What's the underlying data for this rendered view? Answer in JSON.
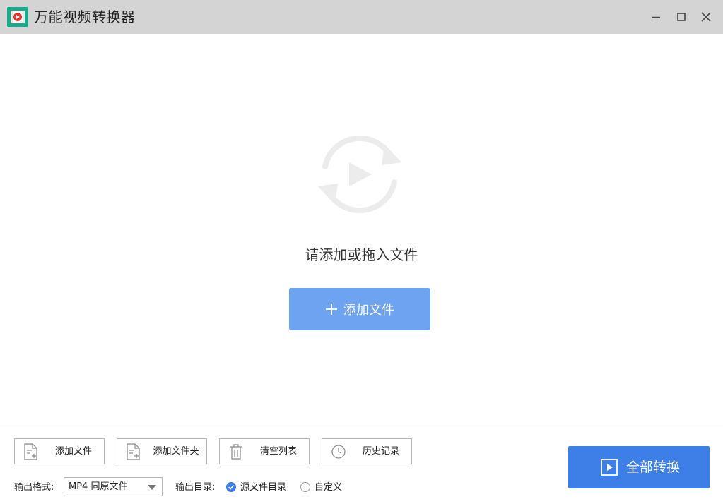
{
  "window": {
    "title": "万能视频转换器",
    "controls": [
      "minimize-icon",
      "maximize-icon",
      "close-icon"
    ]
  },
  "empty_state": {
    "icon": "convert-video-icon",
    "prompt": "请添加或拖入文件",
    "add_button_label": "添加文件"
  },
  "toolbar": {
    "buttons": [
      {
        "icon": "add-file-icon",
        "label": "添加文件"
      },
      {
        "icon": "add-folder-icon",
        "label": "添加文件夹"
      },
      {
        "icon": "trash-icon",
        "label": "清空列表"
      },
      {
        "icon": "clock-icon",
        "label": "历史记录"
      }
    ]
  },
  "output": {
    "format_label": "输出格式:",
    "format_value": "MP4 同原文件",
    "dir_label": "输出目录:",
    "dir_options": [
      "源文件目录",
      "自定义"
    ],
    "dir_selected": "源文件目录"
  },
  "convert_all_label": "全部转换",
  "colors": {
    "accent": "#3d7fe6",
    "accent_light": "#6da3f0",
    "titlebar": "#d4d4d4",
    "logo": "#1aa98a"
  }
}
